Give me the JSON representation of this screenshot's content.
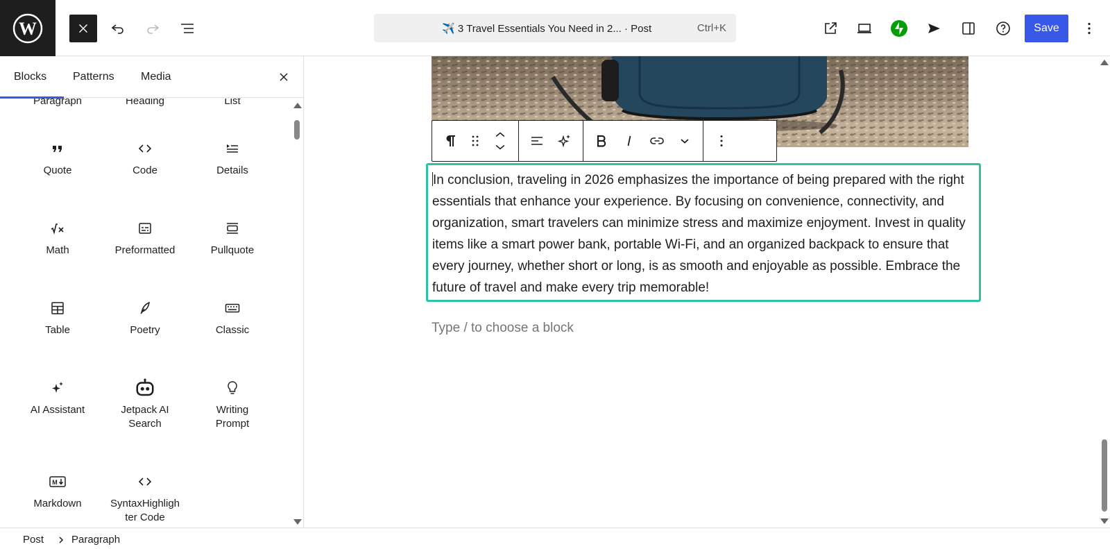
{
  "header": {
    "post_title": "✈️ 3 Travel Essentials You Need in 2... · Post",
    "shortcut": "Ctrl+K",
    "save_label": "Save",
    "accent_color": "#3858e9"
  },
  "inserter": {
    "tabs": [
      {
        "label": "Blocks",
        "active": true
      },
      {
        "label": "Patterns",
        "active": false
      },
      {
        "label": "Media",
        "active": false
      }
    ],
    "partial_labels": [
      "Paragraph",
      "Heading",
      "List"
    ],
    "blocks": [
      {
        "label": "Quote",
        "icon": "quote-icon"
      },
      {
        "label": "Code",
        "icon": "code-icon"
      },
      {
        "label": "Details",
        "icon": "details-icon"
      },
      {
        "label": "Math",
        "icon": "math-icon"
      },
      {
        "label": "Preformatted",
        "icon": "preformatted-icon"
      },
      {
        "label": "Pullquote",
        "icon": "pullquote-icon"
      },
      {
        "label": "Table",
        "icon": "table-icon"
      },
      {
        "label": "Poetry",
        "icon": "poetry-icon"
      },
      {
        "label": "Classic",
        "icon": "keyboard-icon"
      },
      {
        "label": "AI Assistant",
        "icon": "sparkles-icon"
      },
      {
        "label": "Jetpack AI Search",
        "icon": "robot-icon"
      },
      {
        "label": "Writing Prompt",
        "icon": "lightbulb-icon"
      },
      {
        "label": "Markdown",
        "icon": "markdown-icon"
      },
      {
        "label": "SyntaxHighlighter Code",
        "icon": "code-icon"
      }
    ]
  },
  "editor": {
    "paragraph": "In conclusion, traveling in 2026 emphasizes the importance of being prepared with the right essentials that enhance your experience. By focusing on convenience, connectivity, and organization, smart travelers can minimize stress and maximize enjoyment. Invest in quality items like a smart power bank, portable Wi-Fi, and an organized backpack to ensure that every journey, whether short or long, is as smooth and enjoyable as possible. Embrace the future of travel and make every trip memorable!",
    "placeholder": "Type / to choose a block",
    "selection_color": "#2bc3a4"
  },
  "footer": {
    "breadcrumb": [
      "Post",
      "Paragraph"
    ]
  }
}
